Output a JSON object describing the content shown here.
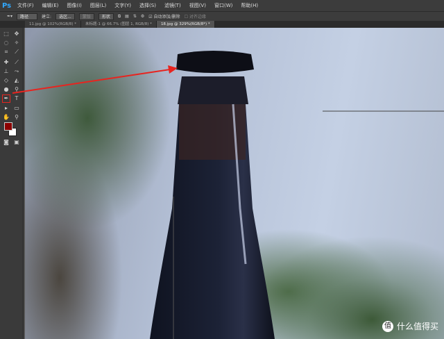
{
  "app": {
    "logo": "Ps"
  },
  "menu": [
    "文件(F)",
    "编辑(E)",
    "图像(I)",
    "图层(L)",
    "文字(Y)",
    "选择(S)",
    "滤镜(T)",
    "视图(V)",
    "窗口(W)",
    "帮助(H)"
  ],
  "options": {
    "mode": "路径",
    "make_label": "建立:",
    "selection": "选区...",
    "mask": "蒙版",
    "shape": "形状",
    "auto_add": "自动添加/删除",
    "align_edges": "对齐边缘"
  },
  "tabs": [
    "11.jpg @ 102%(RGB/8) *",
    "未标题-1 @ 66.7% (图层 1, RGB/8) *",
    "18.jpg @ 329%(RGB/8*) *"
  ],
  "colors": {
    "foreground": "#8b0000",
    "background": "#ffffff",
    "accent": "#e8241f"
  },
  "watermark": {
    "icon": "值",
    "text": "什么值得买"
  }
}
